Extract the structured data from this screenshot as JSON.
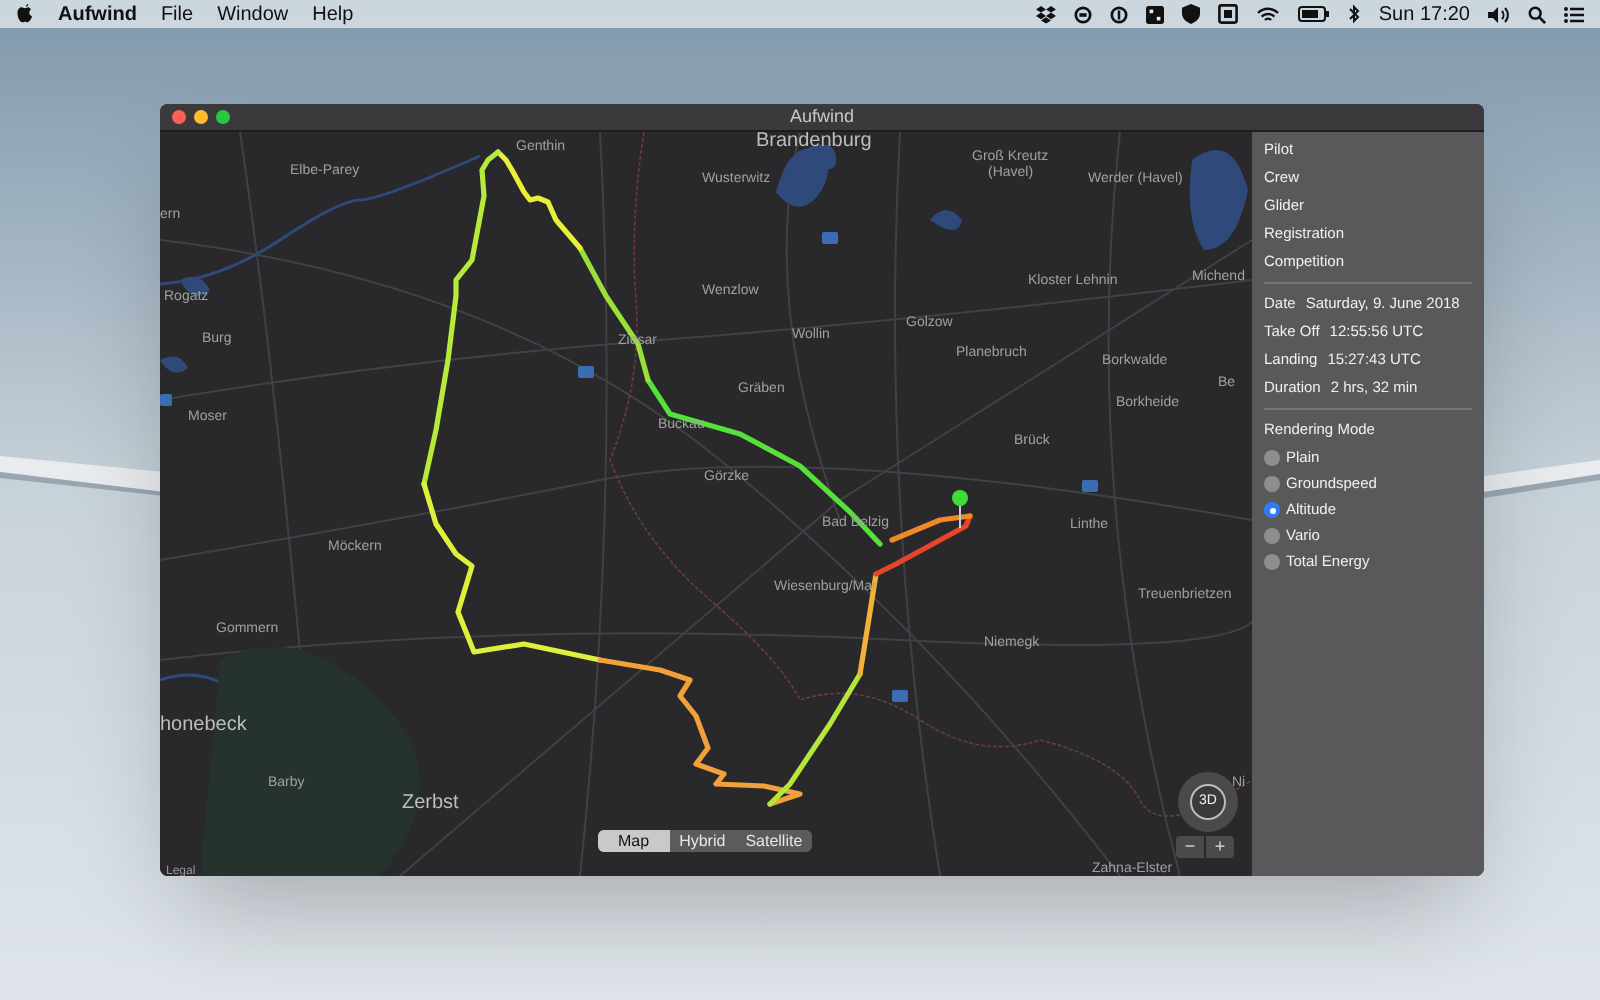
{
  "menu_bar": {
    "app": "Aufwind",
    "menus": [
      "File",
      "Window",
      "Help"
    ],
    "clock": "Sun 17:20"
  },
  "window": {
    "title": "Aufwind"
  },
  "map": {
    "labels": [
      {
        "text": "Brandenburg",
        "kind": "city"
      },
      {
        "text": "Genthin",
        "kind": "town"
      },
      {
        "text": "Elbe-Parey",
        "kind": "town"
      },
      {
        "text": "Wusterwitz",
        "kind": "town"
      },
      {
        "text": "Groß Kreutz",
        "kind": "town"
      },
      {
        "text": "(Havel)",
        "kind": "town"
      },
      {
        "text": "Werder (Havel)",
        "kind": "town"
      },
      {
        "text": "Kloster Lehnin",
        "kind": "town"
      },
      {
        "text": "Michend",
        "kind": "town"
      },
      {
        "text": "ern",
        "kind": "town"
      },
      {
        "text": "Rogatz",
        "kind": "town"
      },
      {
        "text": "Wenzlow",
        "kind": "town"
      },
      {
        "text": "Wollin",
        "kind": "town"
      },
      {
        "text": "Golzow",
        "kind": "town"
      },
      {
        "text": "Planebruch",
        "kind": "town"
      },
      {
        "text": "Borkwalde",
        "kind": "town"
      },
      {
        "text": "Be",
        "kind": "town"
      },
      {
        "text": "Burg",
        "kind": "town"
      },
      {
        "text": "Ziesar",
        "kind": "town"
      },
      {
        "text": "Gräben",
        "kind": "town"
      },
      {
        "text": "Borkheide",
        "kind": "town"
      },
      {
        "text": "Moser",
        "kind": "town"
      },
      {
        "text": "Buckau",
        "kind": "town"
      },
      {
        "text": "Brück",
        "kind": "town"
      },
      {
        "text": "Görzke",
        "kind": "town"
      },
      {
        "text": "Bad Belzig",
        "kind": "town"
      },
      {
        "text": "Linthe",
        "kind": "town"
      },
      {
        "text": "Möckern",
        "kind": "town"
      },
      {
        "text": "Wiesenburg/Mar",
        "kind": "town"
      },
      {
        "text": "Treuenbrietzen",
        "kind": "town"
      },
      {
        "text": "Niemegk",
        "kind": "town"
      },
      {
        "text": "Gommern",
        "kind": "town"
      },
      {
        "text": "honebeck",
        "kind": "city"
      },
      {
        "text": "Barby",
        "kind": "town"
      },
      {
        "text": "Zerbst",
        "kind": "city"
      },
      {
        "text": "Zahna-Elster",
        "kind": "town"
      },
      {
        "text": "Ni",
        "kind": "town"
      },
      {
        "text": "Legal",
        "kind": "legal"
      }
    ],
    "map_types": [
      {
        "label": "Map",
        "selected": true
      },
      {
        "label": "Hybrid",
        "selected": false
      },
      {
        "label": "Satellite",
        "selected": false
      }
    ],
    "compass": "3D",
    "zoom_out": "−",
    "zoom_in": "+"
  },
  "sidebar": {
    "fields": [
      "Pilot",
      "Crew",
      "Glider",
      "Registration",
      "Competition"
    ],
    "flight": [
      {
        "label": "Date",
        "value": "Saturday, 9. June 2018"
      },
      {
        "label": "Take Off",
        "value": "12:55:56 UTC"
      },
      {
        "label": "Landing",
        "value": "15:27:43 UTC"
      },
      {
        "label": "Duration",
        "value": "2 hrs, 32 min"
      }
    ],
    "rendering_mode": {
      "title": "Rendering Mode",
      "options": [
        {
          "label": "Plain",
          "selected": false
        },
        {
          "label": "Groundspeed",
          "selected": false
        },
        {
          "label": "Altitude",
          "selected": true
        },
        {
          "label": "Vario",
          "selected": false
        },
        {
          "label": "Total Energy",
          "selected": false
        }
      ]
    }
  }
}
